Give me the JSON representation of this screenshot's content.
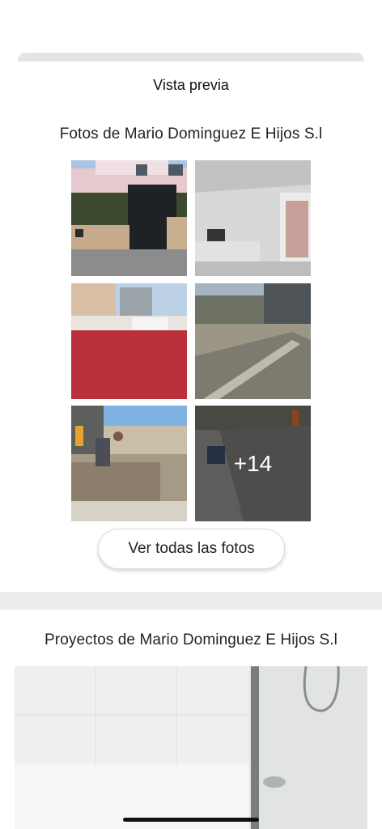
{
  "header": {
    "title": "Vista previa"
  },
  "photos_section": {
    "title": "Fotos de Mario Dominguez E Hijos S.l",
    "photos": [
      {
        "description": "gate-facade"
      },
      {
        "description": "interior-room"
      },
      {
        "description": "red-terrace"
      },
      {
        "description": "concrete-slab"
      },
      {
        "description": "worker-foundation"
      },
      {
        "description": "concrete-pour",
        "more_count": "+14"
      }
    ],
    "view_all_label": "Ver todas las fotos"
  },
  "projects_section": {
    "title": "Proyectos de Mario Dominguez E Hijos S.l"
  }
}
